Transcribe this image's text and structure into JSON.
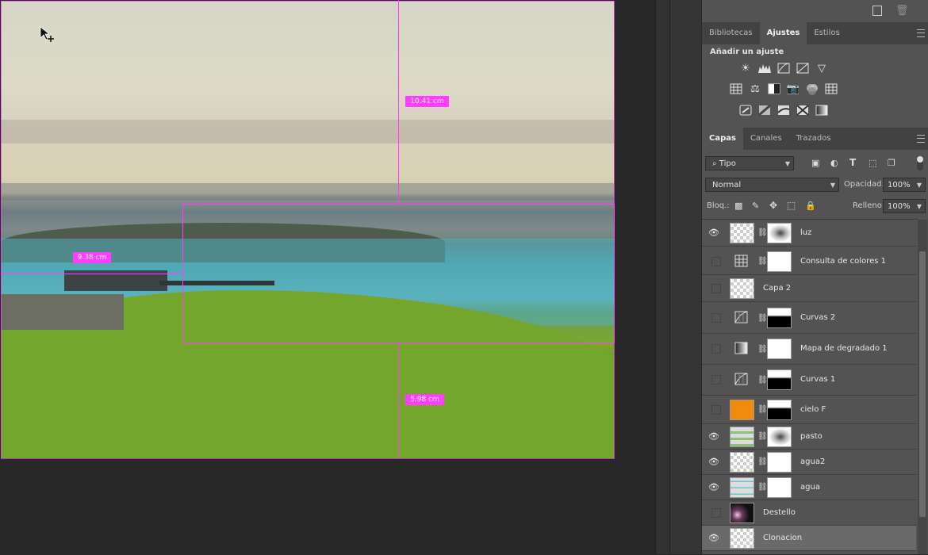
{
  "canvas": {
    "measure_top": "10.41 cm",
    "measure_left": "9.38 cm",
    "measure_bottom": "5.98 cm"
  },
  "top_icons": [
    "new-layer-icon",
    "trash-icon"
  ],
  "adjust_panel": {
    "tabs": [
      "Bibliotecas",
      "Ajustes",
      "Estilos"
    ],
    "active_tab": "Ajustes",
    "title": "Añadir un ajuste",
    "icons_row1": [
      "brightness-icon",
      "levels-icon",
      "curves-icon",
      "exposure-icon",
      "vibrance-icon"
    ],
    "icons_row2": [
      "hue-saturation-icon",
      "color-balance-icon",
      "black-white-icon",
      "photo-filter-icon",
      "channel-mixer-icon",
      "color-lookup-icon"
    ],
    "icons_row3": [
      "invert-icon",
      "posterize-icon",
      "threshold-icon",
      "selective-color-icon",
      "gradient-map-icon"
    ]
  },
  "layers_panel": {
    "tabs": [
      "Capas",
      "Canales",
      "Trazados"
    ],
    "active_tab": "Capas",
    "filter_label": "Tipo",
    "blend_mode": "Normal",
    "opacity_label": "Opacidad:",
    "opacity_value": "100%",
    "lock_label": "Bloq.:",
    "fill_label": "Relleno:",
    "fill_value": "100%",
    "layers": [
      {
        "name": "luz",
        "visible": true,
        "has_mask": true,
        "thumb": "transparent",
        "mask": "light"
      },
      {
        "name": "Consulta de colores 1",
        "visible": false,
        "has_mask": true,
        "thumb": "grid",
        "mask": "white"
      },
      {
        "name": "Capa 2",
        "visible": false,
        "has_mask": false,
        "thumb": "transparent"
      },
      {
        "name": "Curvas 2",
        "visible": false,
        "has_mask": true,
        "thumb": "curves",
        "mask": "dark"
      },
      {
        "name": "Mapa de degradado 1",
        "visible": false,
        "has_mask": true,
        "thumb": "gradient",
        "mask": "white"
      },
      {
        "name": "Curvas 1",
        "visible": false,
        "has_mask": true,
        "thumb": "curves",
        "mask": "dark"
      },
      {
        "name": "cielo F",
        "visible": false,
        "has_mask": true,
        "thumb": "orange",
        "mask": "dark"
      },
      {
        "name": "pasto",
        "visible": true,
        "has_mask": true,
        "thumb": "grass",
        "mask": "light"
      },
      {
        "name": "agua2",
        "visible": true,
        "has_mask": true,
        "thumb": "transparent",
        "mask": "white"
      },
      {
        "name": "agua",
        "visible": true,
        "has_mask": true,
        "thumb": "water",
        "mask": "white"
      },
      {
        "name": "Destello",
        "visible": false,
        "has_mask": false,
        "thumb": "flare"
      },
      {
        "name": "Clonacion",
        "visible": true,
        "has_mask": false,
        "thumb": "transparent",
        "selected": true
      }
    ]
  }
}
